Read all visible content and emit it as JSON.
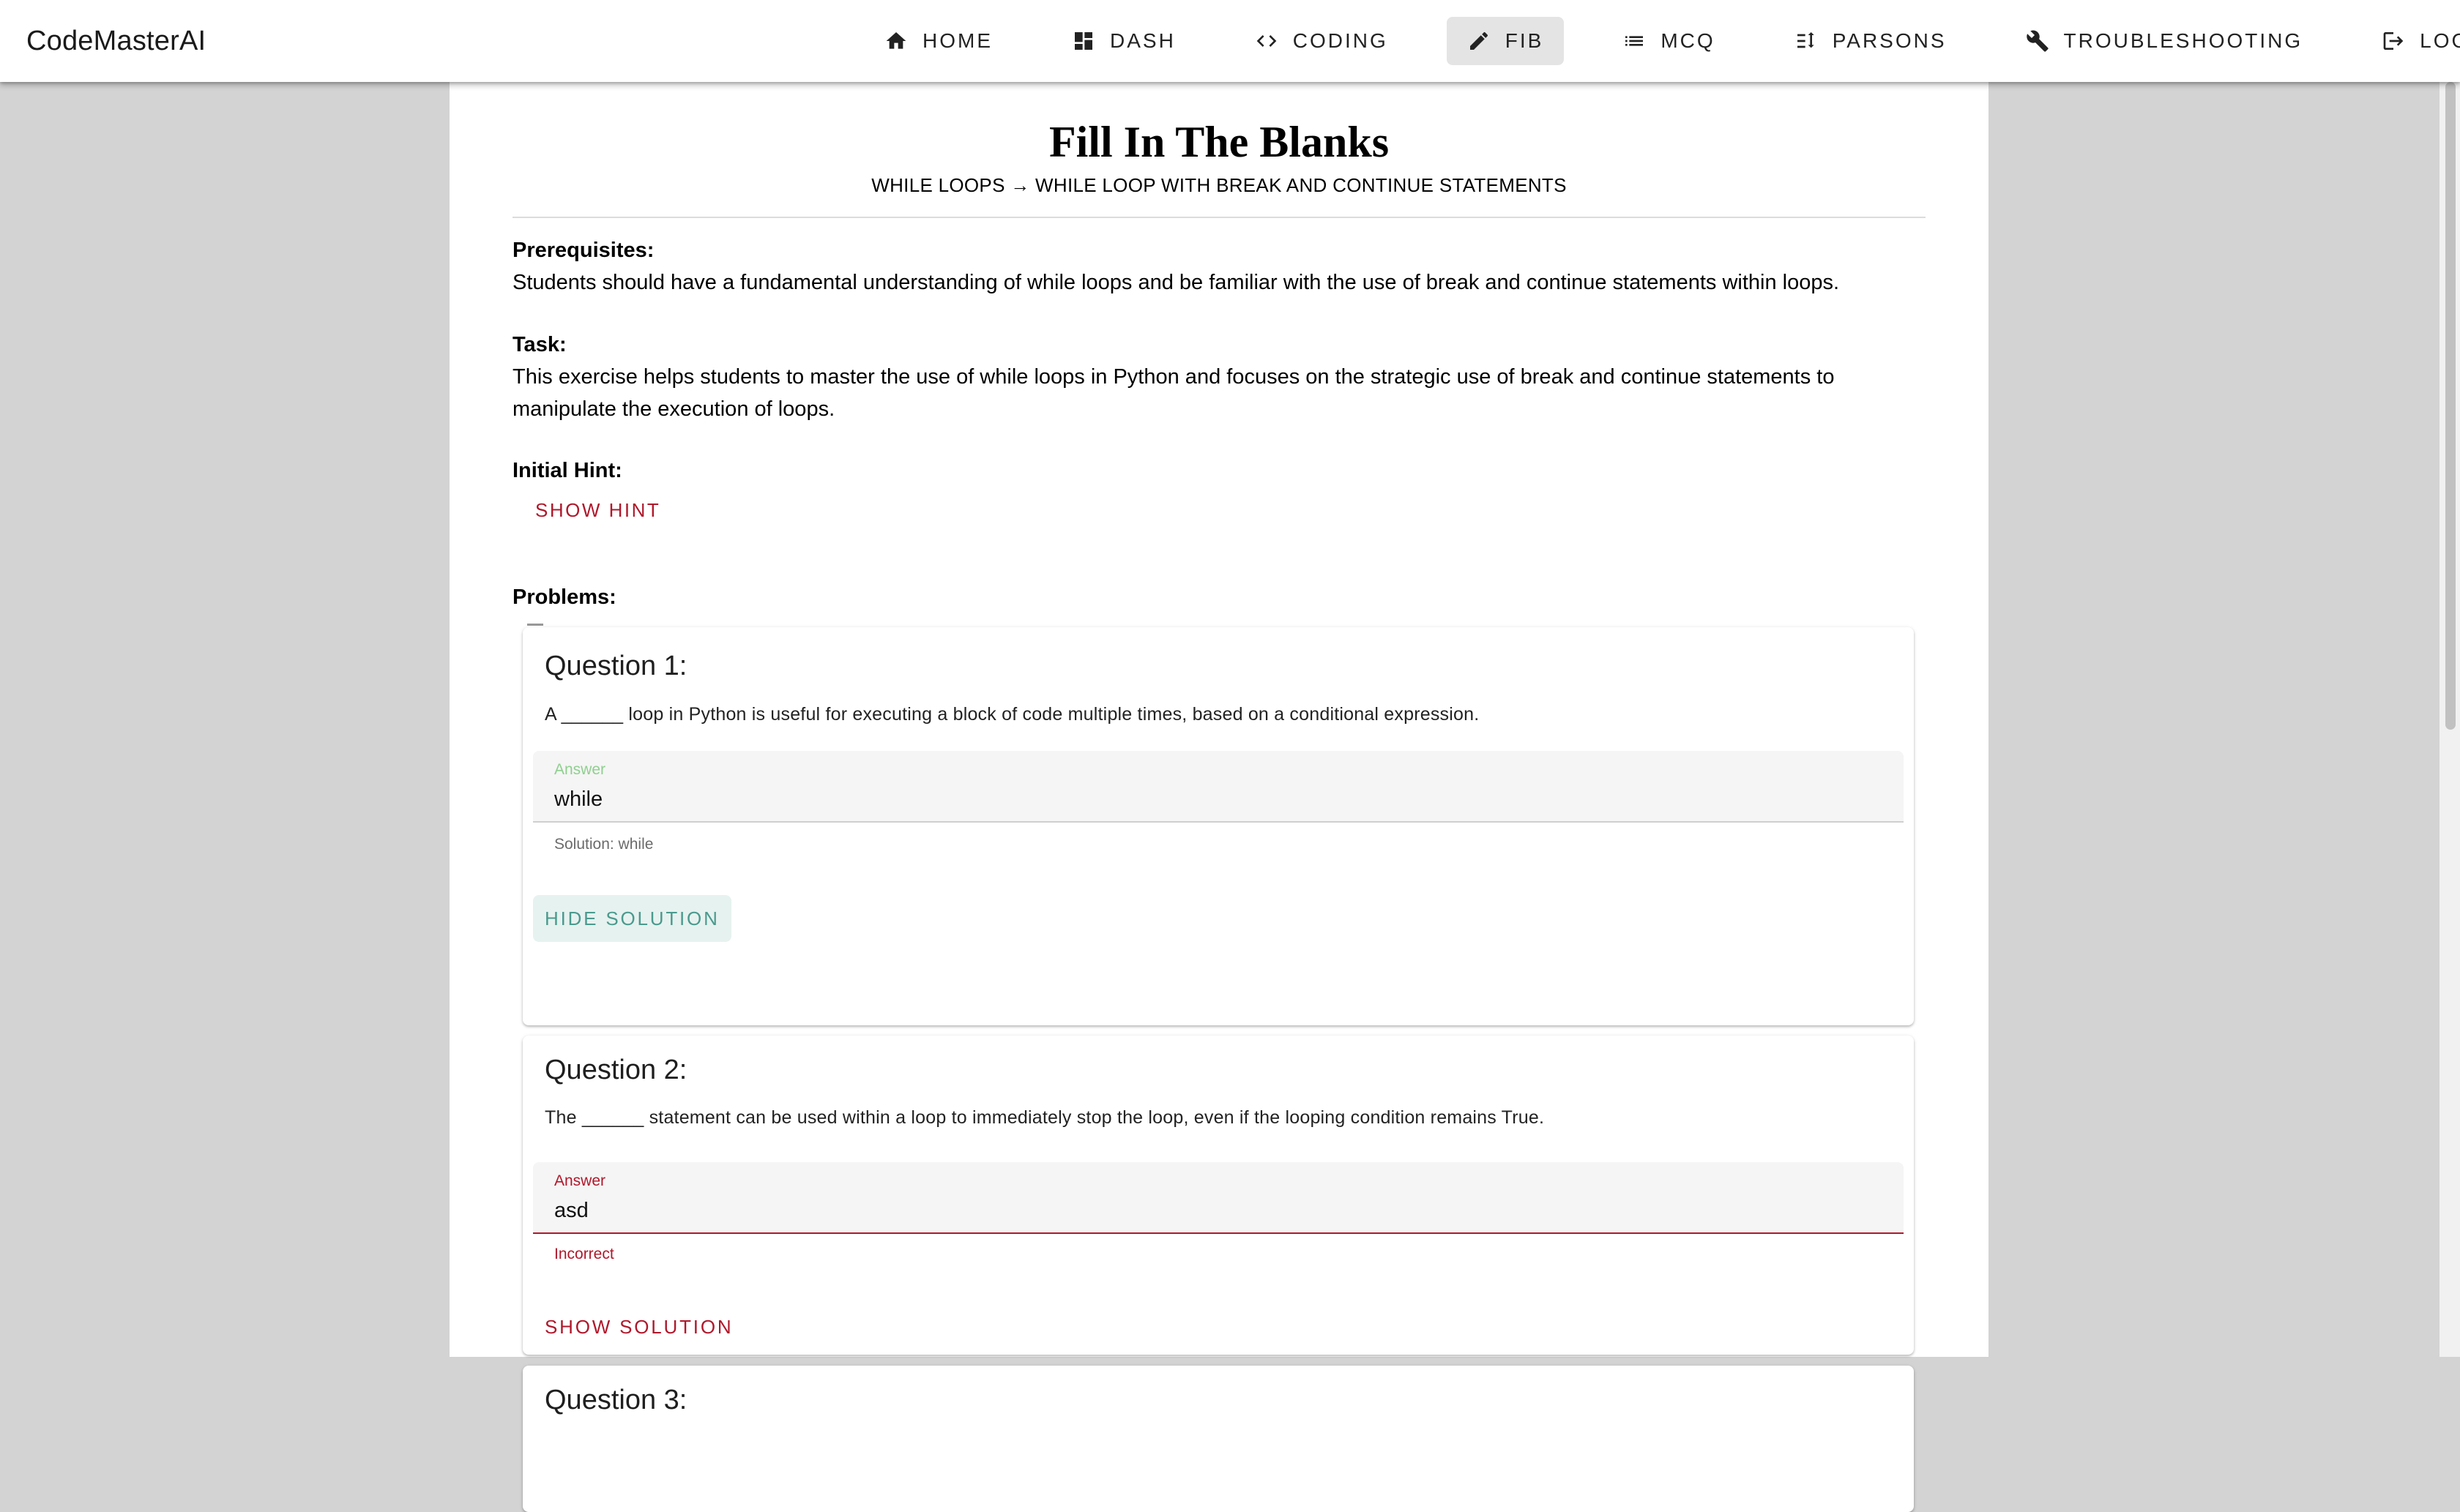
{
  "app": {
    "brand": "CodeMasterAI"
  },
  "nav": [
    {
      "label": "Home",
      "icon": "home-icon"
    },
    {
      "label": "Dash",
      "icon": "dashboard-icon"
    },
    {
      "label": "Coding",
      "icon": "code-icon"
    },
    {
      "label": "FIB",
      "icon": "pencil-icon",
      "active": true
    },
    {
      "label": "MCQ",
      "icon": "list-icon"
    },
    {
      "label": "Parsons",
      "icon": "sort-icon"
    },
    {
      "label": "Troubleshooting",
      "icon": "wrench-icon"
    },
    {
      "label": "Logout",
      "icon": "logout-icon"
    }
  ],
  "page": {
    "title": "Fill In The Blanks",
    "breadcrumb": "WHILE LOOPS → WHILE LOOP WITH BREAK AND CONTINUE STATEMENTS"
  },
  "prerequisites": {
    "label": "Prerequisites:",
    "text": "Students should have a fundamental understanding of while loops and be familiar with the use of break and continue statements within loops."
  },
  "task": {
    "label": "Task:",
    "text": "This exercise helps students to master the use of while loops in Python and focuses on the strategic use of break and continue statements to manipulate the execution of loops."
  },
  "hint": {
    "label": "Initial Hint:",
    "button": "Show Hint"
  },
  "problems": {
    "label": "Problems:",
    "questions": [
      {
        "title": "Question 1:",
        "text": "A ______ loop in Python is useful for executing a block of code multiple times, based on a conditional expression.",
        "answer_label": "Answer",
        "answer_value": "while",
        "helper": "Solution: while",
        "button": "Hide Solution",
        "state": "correct"
      },
      {
        "title": "Question 2:",
        "text": "The ______ statement can be used within a loop to immediately stop the loop, even if the looping condition remains True.",
        "answer_label": "Answer",
        "answer_value": "asd",
        "helper": "Incorrect",
        "button": "Show Solution",
        "state": "incorrect"
      },
      {
        "title": "Question 3:"
      }
    ]
  },
  "colors": {
    "accent_red": "#b0182b",
    "correct_green": "#8fcf8f",
    "teal": "#4a9a8e",
    "teal_bg": "#e6f2ef",
    "active_nav_bg": "#e4e4e4"
  }
}
